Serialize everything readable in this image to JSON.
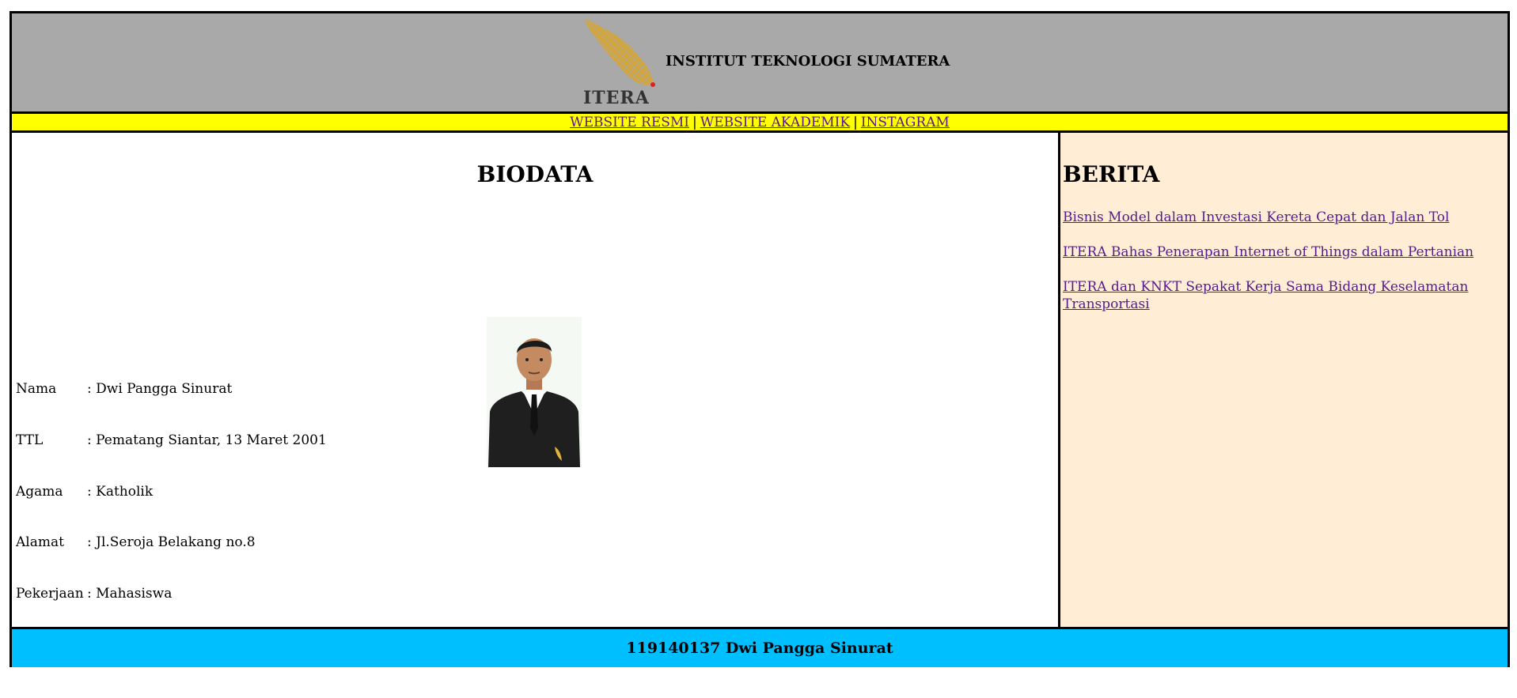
{
  "header": {
    "logo_text": "ITERA",
    "title": "INSTITUT TEKNOLOGI SUMATERA"
  },
  "nav": {
    "links": [
      "WEBSITE RESMI",
      "WEBSITE AKADEMIK",
      "INSTAGRAM"
    ],
    "separator": "|"
  },
  "biodata": {
    "title": "BIODATA",
    "rows": [
      {
        "label": "Nama",
        "value": ": Dwi Pangga Sinurat"
      },
      {
        "label": "TTL",
        "value": ": Pematang Siantar, 13 Maret 2001"
      },
      {
        "label": "Agama",
        "value": ": Katholik"
      },
      {
        "label": "Alamat",
        "value": ": Jl.Seroja Belakang no.8"
      },
      {
        "label": "Pekerjaan",
        "value": ": Mahasiswa"
      }
    ]
  },
  "berita": {
    "title": "BERITA",
    "items": [
      "Bisnis Model dalam Investasi Kereta Cepat dan Jalan Tol",
      "ITERA Bahas Penerapan Internet of Things dalam Pertanian",
      "ITERA dan KNKT Sepakat Kerja Sama Bidang Keselamatan Transportasi"
    ]
  },
  "footer": {
    "text": "119140137 Dwi Pangga Sinurat"
  },
  "colors": {
    "header_bg": "#a9a9a9",
    "nav_bg": "#ffff00",
    "sidebar_bg": "#ffeed5",
    "footer_bg": "#00bfff",
    "link": "#551a8b",
    "logo_gold": "#d4a63a"
  }
}
